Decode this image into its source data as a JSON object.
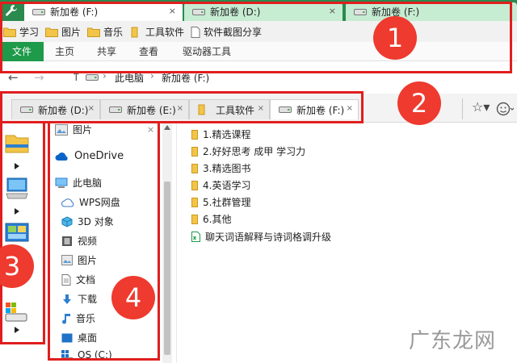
{
  "browser_tabs": [
    {
      "label": "新加卷 (F:)",
      "close": "×"
    },
    {
      "label": "新加卷 (D:)",
      "close": "×"
    },
    {
      "label": "新加卷 (F:)",
      "close": ""
    }
  ],
  "bookmarks": [
    "学习",
    "图片",
    "音乐",
    "工具软件",
    "软件截图分享"
  ],
  "ribbon": {
    "tabs": [
      "文件",
      "主页",
      "共享",
      "查看",
      "驱动器工具"
    ]
  },
  "address": {
    "back": "←",
    "forward": "→",
    "up": "↑",
    "path": [
      "此电脑",
      "新加卷 (F:)"
    ],
    "sep": "›"
  },
  "inner_tabs": [
    {
      "label": "新加卷 (D:)",
      "close": "×"
    },
    {
      "label": "新加卷 (E:)",
      "close": "×"
    },
    {
      "label": "工具软件",
      "close": "×"
    },
    {
      "label": "新加卷 (F:)",
      "close": "×"
    }
  ],
  "toolbar_right": {
    "star": "☆▾"
  },
  "nav_items": [
    "图片",
    "OneDrive",
    "此电脑",
    "WPS网盘",
    "3D 对象",
    "视频",
    "图片",
    "文档",
    "下载",
    "音乐",
    "桌面",
    "OS (C:)"
  ],
  "nav_close": "×",
  "files": [
    "1.精选课程",
    "2.好好思考 成甲 学习力",
    "3.精选图书",
    "4.英语学习",
    "5.社群管理",
    "6.其他",
    "聊天词语解释与诗词格调升级"
  ],
  "callouts": [
    "1",
    "2",
    "3",
    "4"
  ],
  "callout_color": "#e01e1e",
  "watermark": "广东龙网",
  "colors": {
    "tab_green": "#2b8a4e",
    "ribbon_file": "#1e9a4a",
    "folder": "#f2c44a"
  }
}
